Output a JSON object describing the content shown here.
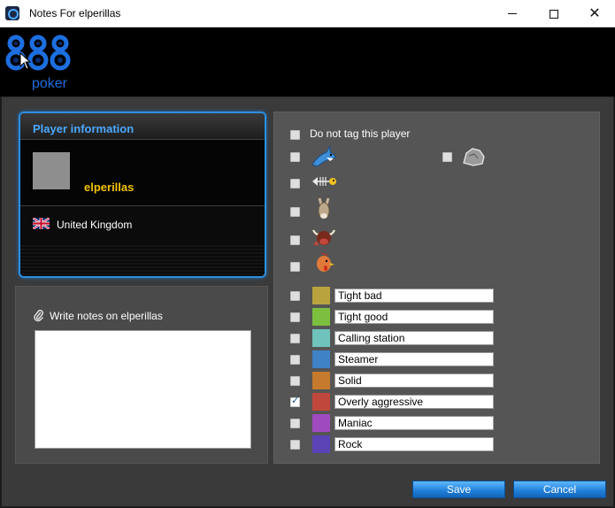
{
  "window": {
    "title": "Notes For elperillas",
    "minimize_label": "Minimize",
    "maximize_label": "Maximize",
    "close_label": "Close"
  },
  "logo": {
    "brand_number": "888",
    "brand_word": "poker",
    "colors": {
      "primary": "#1d6fe0",
      "dark": "#0c2b6b"
    }
  },
  "player_card": {
    "title": "Player information",
    "name": "elperillas",
    "country": "United Kingdom",
    "flag_icon": "uk-flag-icon"
  },
  "notes": {
    "label": "Write notes on elperillas",
    "value": "",
    "icon": "paperclip-icon"
  },
  "tags": {
    "do_not_tag_label": "Do not tag this player",
    "do_not_tag_checked": false,
    "icon_tags": [
      {
        "icon": "shark-icon",
        "checked": false
      },
      {
        "icon": "rock-icon",
        "checked": false
      },
      {
        "icon": "fish-icon",
        "checked": false
      },
      {
        "icon": "donkey-icon",
        "checked": false
      },
      {
        "icon": "bull-icon",
        "checked": false
      },
      {
        "icon": "chicken-icon",
        "checked": false
      }
    ],
    "color_tags": [
      {
        "label": "Tight bad",
        "color": "#b8a33e",
        "checked": false
      },
      {
        "label": "Tight good",
        "color": "#7cbf3f",
        "checked": false
      },
      {
        "label": "Calling station",
        "color": "#6fc3bc",
        "checked": false
      },
      {
        "label": "Steamer",
        "color": "#3f82c6",
        "checked": false
      },
      {
        "label": "Solid",
        "color": "#c57a2d",
        "checked": false
      },
      {
        "label": "Overly aggressive",
        "color": "#c0473c",
        "checked": true
      },
      {
        "label": "Maniac",
        "color": "#a04ac0",
        "checked": false
      },
      {
        "label": "Rock",
        "color": "#5a44b5",
        "checked": false
      }
    ]
  },
  "buttons": {
    "save": "Save",
    "cancel": "Cancel"
  },
  "colors": {
    "accent": "#2d8fe0",
    "player_name": "#f2c300",
    "button": "#1e7ed8"
  }
}
